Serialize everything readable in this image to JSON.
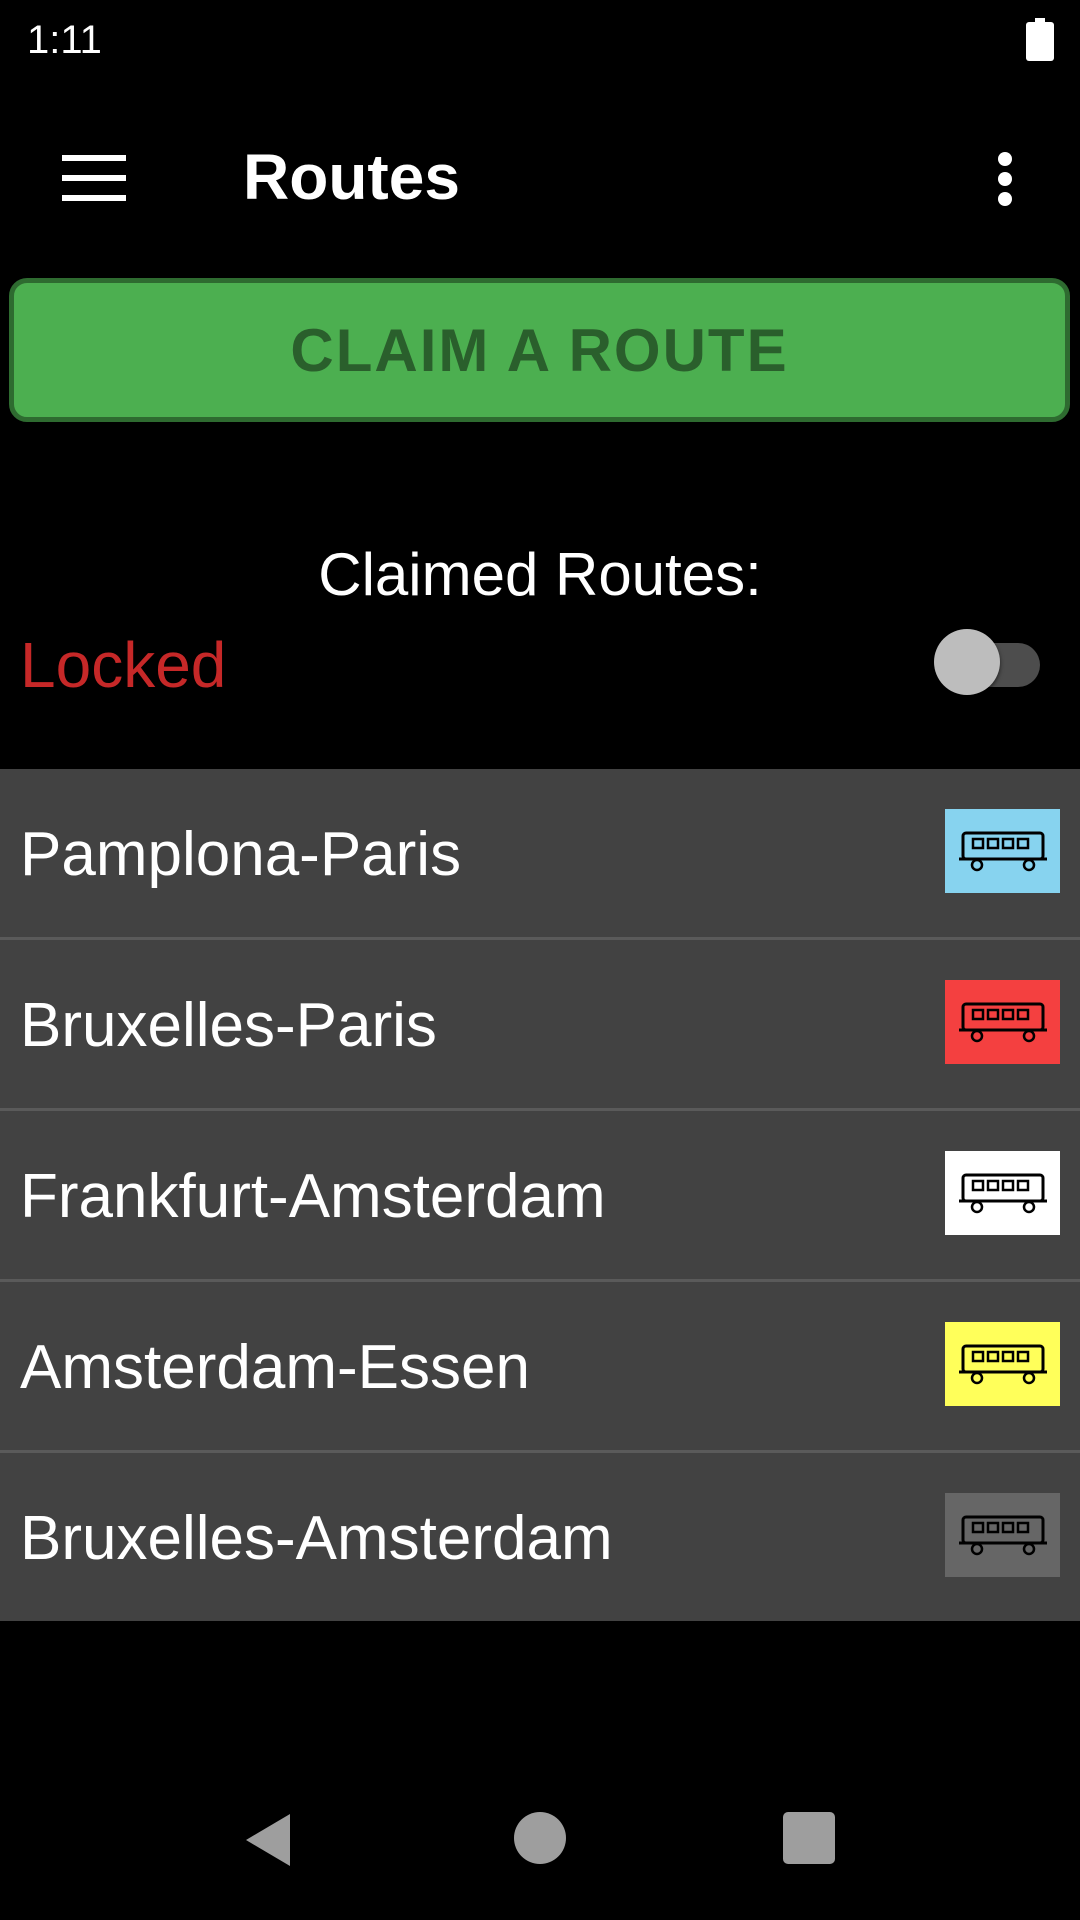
{
  "status_bar": {
    "time": "1:11",
    "battery_icon": "battery-full-icon"
  },
  "app_bar": {
    "title": "Routes",
    "menu_icon": "hamburger-menu-icon",
    "overflow_icon": "more-vert-icon"
  },
  "claim_button": {
    "label": "CLAIM A ROUTE"
  },
  "claimed": {
    "heading": "Claimed Routes:",
    "lock_status": "Locked",
    "lock_color": "#c62828",
    "toggle_on": false
  },
  "routes": [
    {
      "name": "Pamplona-Paris",
      "color": "#87d3ef",
      "icon": "train-car-icon"
    },
    {
      "name": "Bruxelles-Paris",
      "color": "#f44040",
      "icon": "train-car-icon"
    },
    {
      "name": "Frankfurt-Amsterdam",
      "color": "#ffffff",
      "icon": "train-car-icon"
    },
    {
      "name": "Amsterdam-Essen",
      "color": "#ffff5a",
      "icon": "train-car-icon"
    },
    {
      "name": "Bruxelles-Amsterdam",
      "color": "#666666",
      "icon": "train-car-icon"
    }
  ],
  "nav_bar": {
    "back_icon": "back-triangle-icon",
    "home_icon": "home-circle-icon",
    "recents_icon": "recents-square-icon"
  }
}
